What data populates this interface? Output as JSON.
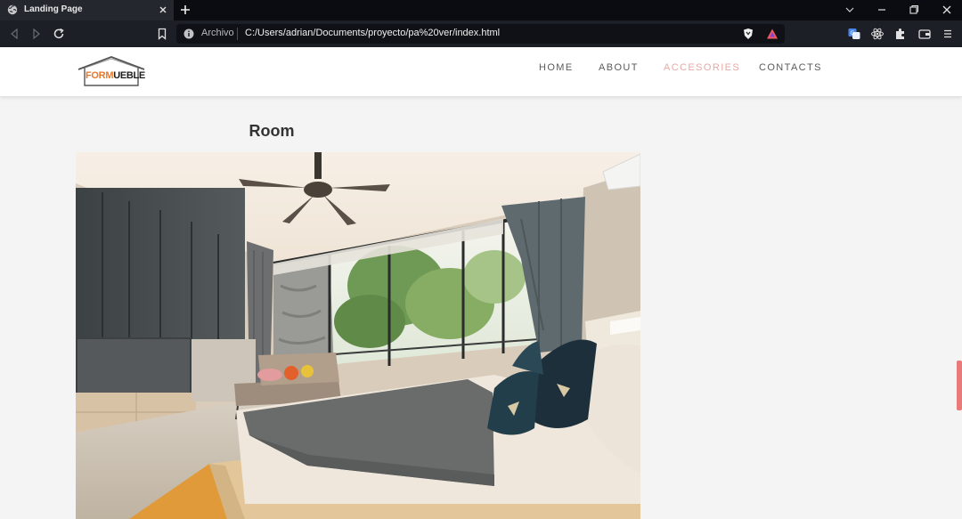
{
  "browser": {
    "tab_title": "Landing Page",
    "address_prefix": "Archivo",
    "address_url": "C:/Users/adrian/Documents/proyecto/pa%20ver/index.html"
  },
  "site": {
    "logo": {
      "part1": "FORM",
      "part2": "UEBLE"
    },
    "nav": [
      {
        "label": "HOME",
        "active": false
      },
      {
        "label": "ABOUT",
        "active": false
      },
      {
        "label": "ACCESORIES",
        "active": true
      },
      {
        "label": "CONTACTS",
        "active": false
      }
    ],
    "section_title": "Room",
    "image_subject": "bedroom-photo"
  },
  "colors": {
    "accent_nav": "#e7a9a4",
    "logo_orange": "#e8792a",
    "scroll_marker": "#e97a7a"
  }
}
